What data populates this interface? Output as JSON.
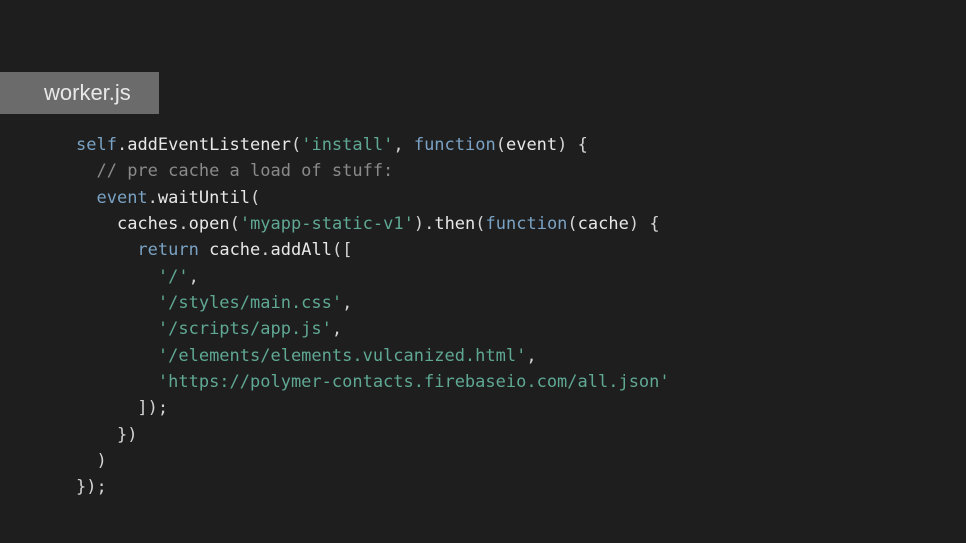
{
  "tab": {
    "label": "worker.js"
  },
  "code": {
    "t": {
      "self": "self",
      "dot": ".",
      "addEventListener": "addEventListener",
      "lp": "(",
      "rp": ")",
      "install": "'install'",
      "comma": ", ",
      "function": "function",
      "event": "event",
      "lb": " {",
      "rb": "}",
      "semi": ";",
      "comment": "// pre cache a load of stuff:",
      "waitUntil": "waitUntil",
      "caches": "caches",
      "open": "open",
      "myapp": "'myapp-static-v1'",
      "then": "then",
      "cache": "cache",
      "return": "return",
      "addAll": "addAll",
      "lbr": "[",
      "rbr": "]",
      "root": "'/'",
      "styles": "'/styles/main.css'",
      "scripts": "'/scripts/app.js'",
      "elements": "'/elements/elements.vulcanized.html'",
      "url": "'https://polymer-contacts.firebaseio.com/all.json'",
      "cma": ","
    }
  }
}
